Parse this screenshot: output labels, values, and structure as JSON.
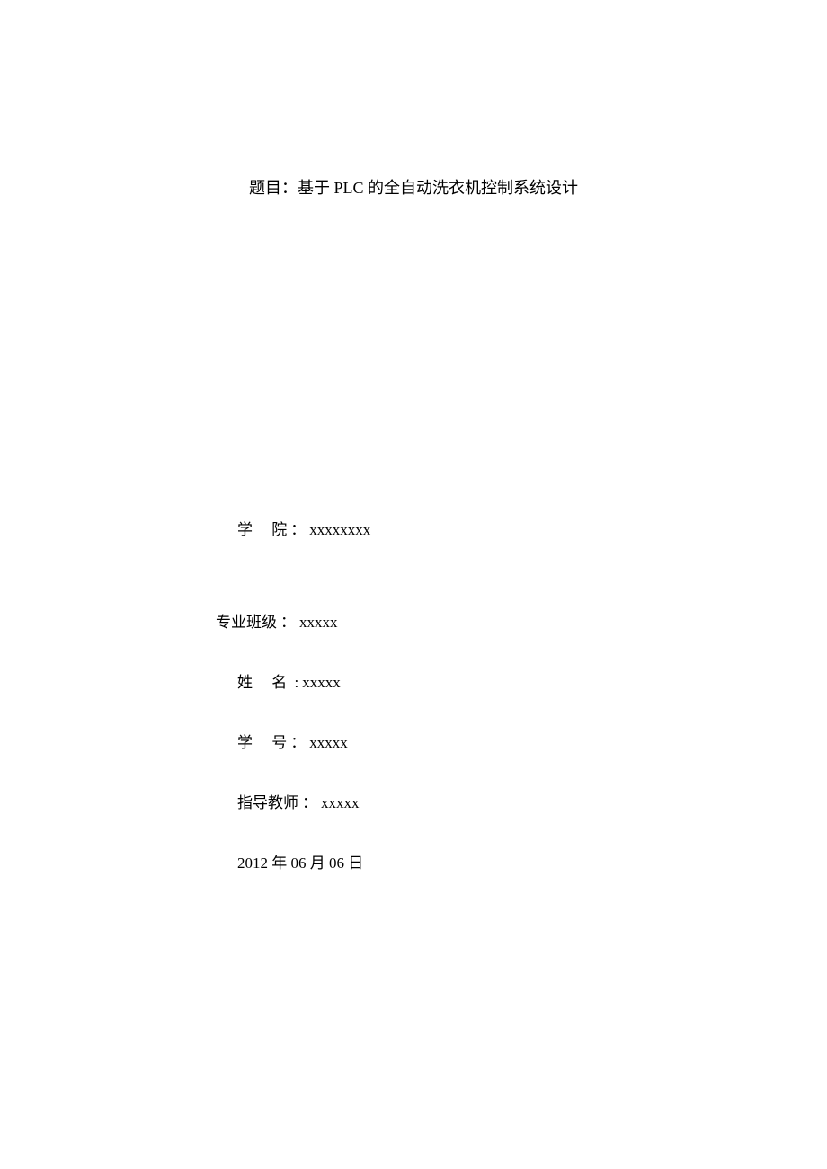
{
  "title_prefix": "题目：",
  "title_text": "基于 PLC 的全自动洗衣机控制系统设计",
  "fields": {
    "college": {
      "label": "学",
      "label2": "院",
      "colon": "：",
      "value": "xxxxxxxx"
    },
    "major": {
      "label": "专业班级",
      "colon": "：",
      "value": "xxxxx"
    },
    "name": {
      "label": "姓",
      "label2": "名",
      "colon": ":",
      "value": "xxxxx"
    },
    "student_id": {
      "label": "学",
      "label2": "号",
      "colon": "：",
      "value": "xxxxx"
    },
    "advisor": {
      "label": "指导教师",
      "colon": "：",
      "value": "xxxxx"
    }
  },
  "date": "2012 年 06 月 06 日"
}
